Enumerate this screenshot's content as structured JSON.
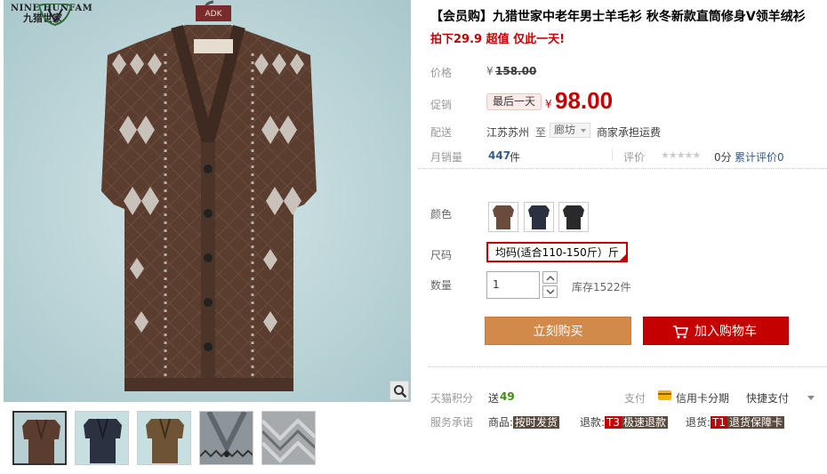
{
  "brand": {
    "name": "NINE HUNFAM",
    "sub": "九猎世家",
    "tag_text": "ADK"
  },
  "product": {
    "title": "【会员购】九猎世家中老年男士羊毛衫 秋冬新款直筒修身V领羊绒衫",
    "subtitle": "拍下29.9 超值 仅此一天!"
  },
  "price": {
    "label": "价格",
    "currency": "¥",
    "original": "158.00",
    "promo_label": "促销",
    "promo_tag": "最后一天",
    "promo_currency": "¥",
    "promo_price": "98.00"
  },
  "shipping": {
    "label": "配送",
    "from": "江苏苏州",
    "to_word": "至",
    "city": "廊坊",
    "note": "商家承担运费"
  },
  "sales": {
    "label": "月销量",
    "count": "447",
    "unit": "件",
    "review_label": "评价",
    "stars": "★★★★★",
    "score": "0分",
    "review_link": "累计评价0"
  },
  "options": {
    "color_label": "颜色",
    "size_label": "尺码",
    "size_value": "均码(适合110-150斤）斤",
    "qty_label": "数量",
    "qty_value": "1",
    "stock": "库存1522件"
  },
  "actions": {
    "buy_now": "立刻购买",
    "add_to_cart": "加入购物车"
  },
  "footer": {
    "points_label": "天猫积分",
    "points_prefix": "送",
    "points_value": "49",
    "pay_label": "支付",
    "credit": "信用卡分期",
    "quick_pay": "快捷支付",
    "service_label": "服务承诺",
    "goods_label": "商品:",
    "goods_tag": "按时发货",
    "refund_label": "退款:",
    "refund_code": "T3",
    "refund_tag": "极速退款",
    "return_label": "退货:",
    "return_code": "T1",
    "return_tag": "退货保障卡"
  },
  "colors": {
    "accent_red": "#c40000",
    "buy_orange": "#d18a4a",
    "sweater_brown": "#5a3d2f",
    "bg_blue": "#b9d3d6"
  },
  "icons": [
    "zoom-icon",
    "cart-icon",
    "credit-card-icon",
    "chevron-down-icon",
    "arrow-up-icon",
    "arrow-down-icon"
  ]
}
